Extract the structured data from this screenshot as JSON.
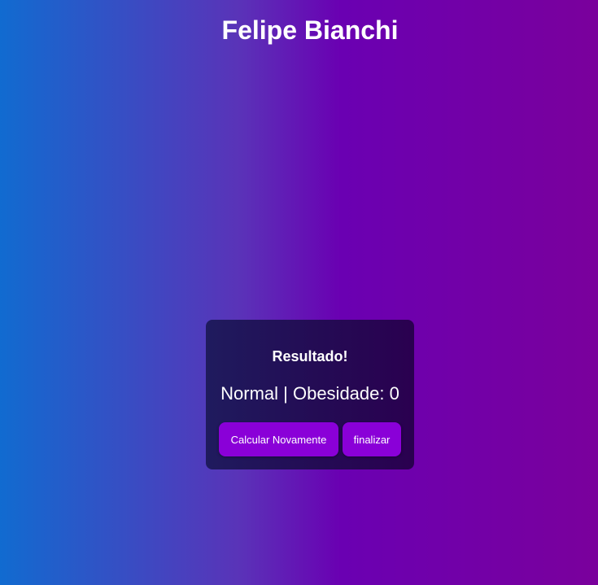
{
  "header": {
    "title": "Felipe Bianchi"
  },
  "result": {
    "heading": "Resultado!",
    "text": "Normal | Obesidade: 0",
    "recalculate_label": "Calcular Novamente",
    "finish_label": "finalizar"
  },
  "colors": {
    "gradient_start": "#116bd0",
    "gradient_end": "#7a009c",
    "card_background": "#1f1b5e",
    "button_background": "#8a00d8",
    "text": "#ffffff"
  }
}
